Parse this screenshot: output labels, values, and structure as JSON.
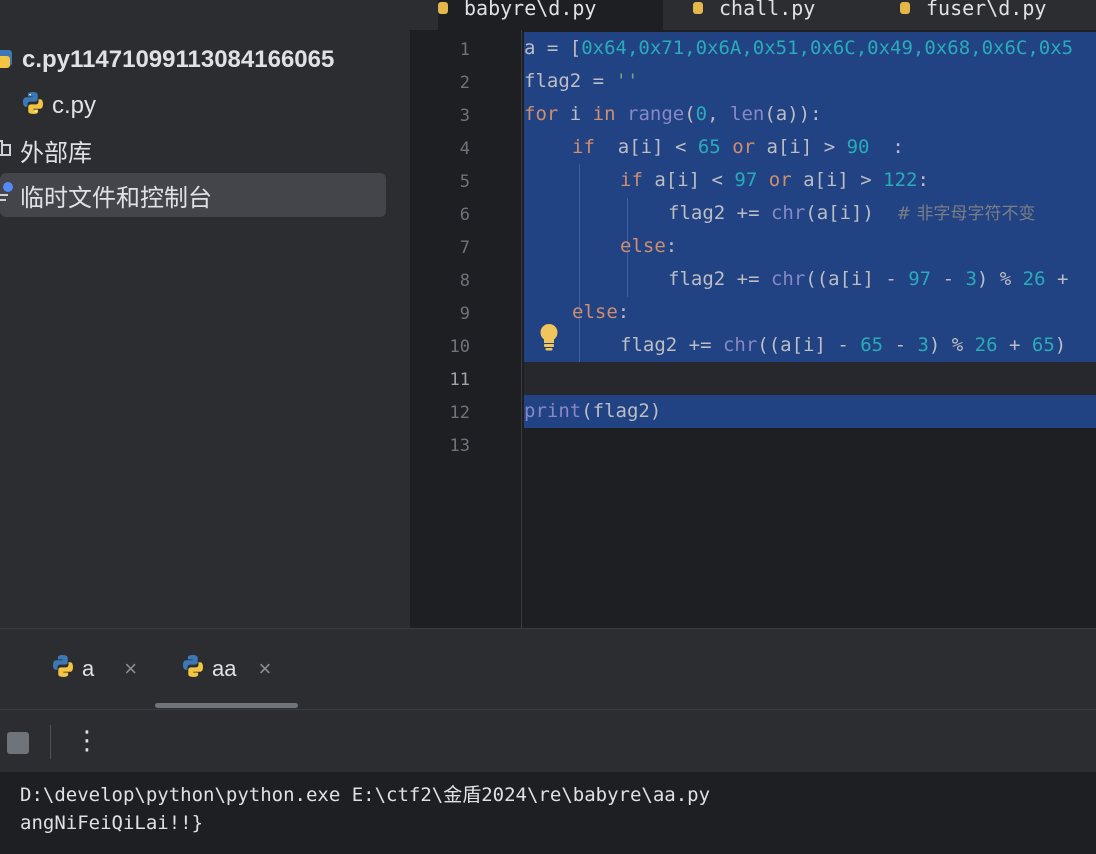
{
  "project": {
    "root_label": "c.py11471099113084166065",
    "file_label": "c.py",
    "external_libs_label": "外部库",
    "scratches_label": "临时文件和控制台"
  },
  "editor_tabs": [
    "babyre\\d.py",
    "chall.py",
    "fuser\\d.py"
  ],
  "gutter": {
    "lines": [
      "1",
      "2",
      "3",
      "4",
      "5",
      "6",
      "7",
      "8",
      "9",
      "10",
      "11",
      "12",
      "13"
    ],
    "current_line": "11"
  },
  "code": {
    "l1": {
      "a1": "a = [",
      "n": "0x64,0x71,0x6A,0x51,0x6C,0x49,0x68,0x6C,0x5"
    },
    "l2": {
      "a1": "flag2 = ",
      "s": "''"
    },
    "l3": {
      "kw1": "for",
      "t1": " i ",
      "kw2": "in",
      "t2": " ",
      "f1": "range",
      "t3": "(",
      "n1": "0",
      "t4": ", ",
      "f2": "len",
      "t5": "(a)):"
    },
    "l4": {
      "kw1": "if",
      "t1": "  a[i] < ",
      "n1": "65",
      "t2": " ",
      "kw2": "or",
      "t3": " a[i] > ",
      "n2": "90",
      "t4": "  :"
    },
    "l5": {
      "kw1": "if",
      "t1": " a[i] < ",
      "n1": "97",
      "t2": " ",
      "kw2": "or",
      "t3": " a[i] > ",
      "n2": "122",
      "t4": ":"
    },
    "l6": {
      "t1": "flag2 += ",
      "f1": "chr",
      "t2": "(a[i])  ",
      "c": "# 非字母字符不变"
    },
    "l7": {
      "kw1": "else",
      "t1": ":"
    },
    "l8": {
      "t1": "flag2 += ",
      "f1": "chr",
      "t2": "((a[i] - ",
      "n1": "97",
      "t3": " - ",
      "n2": "3",
      "t4": ") % ",
      "n3": "26",
      "t5": " +"
    },
    "l9": {
      "kw1": "else",
      "t1": ":"
    },
    "l10": {
      "t1": "flag2 += ",
      "f1": "chr",
      "t2": "((a[i] - ",
      "n1": "65",
      "t3": " - ",
      "n2": "3",
      "t4": ") % ",
      "n3": "26",
      "t5": " + ",
      "n4": "65",
      "t6": ")"
    },
    "l12": {
      "f1": "print",
      "t1": "(flag2)"
    }
  },
  "run_panel": {
    "tabs": [
      {
        "label": "a",
        "close": "×"
      },
      {
        "label": "aa",
        "close": "×"
      }
    ],
    "active_tab": "aa",
    "more_label": "⋮",
    "output": [
      "D:\\develop\\python\\python.exe E:\\ctf2\\金盾2024\\re\\babyre\\aa.py",
      "angNiFeiQiLai!!}"
    ]
  },
  "colors": {
    "selection": "#214283",
    "keyword": "#cf8e6d",
    "number": "#2aacb8",
    "builtin": "#8888c6",
    "comment": "#7a7e85"
  }
}
